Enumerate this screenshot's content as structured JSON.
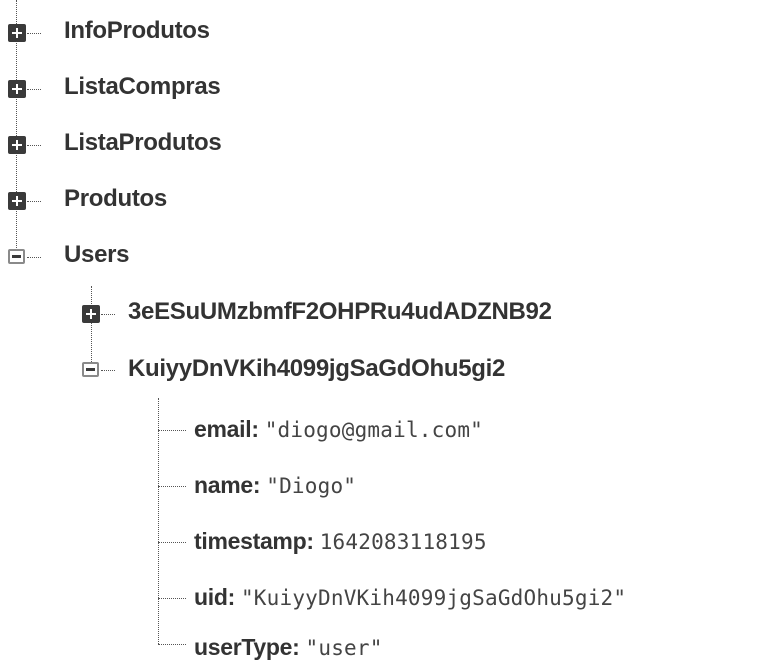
{
  "tree": {
    "root_nodes": [
      {
        "label": "InfoProdutos",
        "state": "collapsed",
        "icon": "expand-icon"
      },
      {
        "label": "ListaCompras",
        "state": "collapsed",
        "icon": "expand-icon"
      },
      {
        "label": "ListaProdutos",
        "state": "collapsed",
        "icon": "expand-icon"
      },
      {
        "label": "Produtos",
        "state": "collapsed",
        "icon": "expand-icon"
      },
      {
        "label": "Users",
        "state": "expanded",
        "icon": "collapse-icon"
      }
    ],
    "users_children": [
      {
        "label": "3eESuUMzbmfF2OHPRu4udADZNB92",
        "state": "collapsed",
        "icon": "expand-icon"
      },
      {
        "label": "KuiyyDnVKih4099jgSaGdOhu5gi2",
        "state": "expanded",
        "icon": "collapse-icon"
      }
    ],
    "user_fields": [
      {
        "key": "email:",
        "value": "\"diogo@gmail.com\""
      },
      {
        "key": "name:",
        "value": "\"Diogo\""
      },
      {
        "key": "timestamp:",
        "value": "1642083118195"
      },
      {
        "key": "uid:",
        "value": "\"KuiyyDnVKih4099jgSaGdOhu5gi2\""
      },
      {
        "key": "userType:",
        "value": "\"user\""
      }
    ]
  },
  "colors": {
    "text": "#333333",
    "value_text": "#444444",
    "icon_dark": "#3a3a3a",
    "connector": "#555555"
  }
}
